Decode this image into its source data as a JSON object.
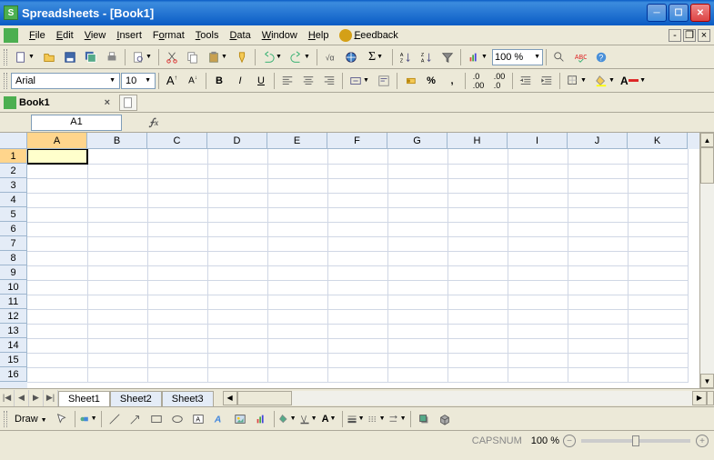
{
  "window": {
    "title": "Spreadsheets - [Book1]"
  },
  "menu": {
    "file": "File",
    "edit": "Edit",
    "view": "View",
    "insert": "Insert",
    "format": "Format",
    "tools": "Tools",
    "data": "Data",
    "window": "Window",
    "help": "Help",
    "feedback": "Feedback"
  },
  "toolbar1": {
    "zoom": "100 %"
  },
  "toolbar2": {
    "font": "Arial",
    "size": "10",
    "inc_font": "A",
    "dec_font": "A",
    "bold": "B",
    "italic": "I",
    "underline": "U"
  },
  "doc_tab": {
    "name": "Book1",
    "close": "×"
  },
  "formula": {
    "cell_ref": "A1",
    "fx": "fx"
  },
  "columns": [
    "A",
    "B",
    "C",
    "D",
    "E",
    "F",
    "G",
    "H",
    "I",
    "J",
    "K"
  ],
  "rows": [
    "1",
    "2",
    "3",
    "4",
    "5",
    "6",
    "7",
    "8",
    "9",
    "10",
    "11",
    "12",
    "13",
    "14",
    "15",
    "16"
  ],
  "active_cell": {
    "col": 0,
    "row": 0
  },
  "sheets": {
    "s1": "Sheet1",
    "s2": "Sheet2",
    "s3": "Sheet3",
    "active": 0
  },
  "drawbar": {
    "label": "Draw",
    "font_a": "A"
  },
  "status": {
    "caps": "CAPSNUM",
    "zoom": "100 %",
    "minus": "−",
    "plus": "+"
  }
}
